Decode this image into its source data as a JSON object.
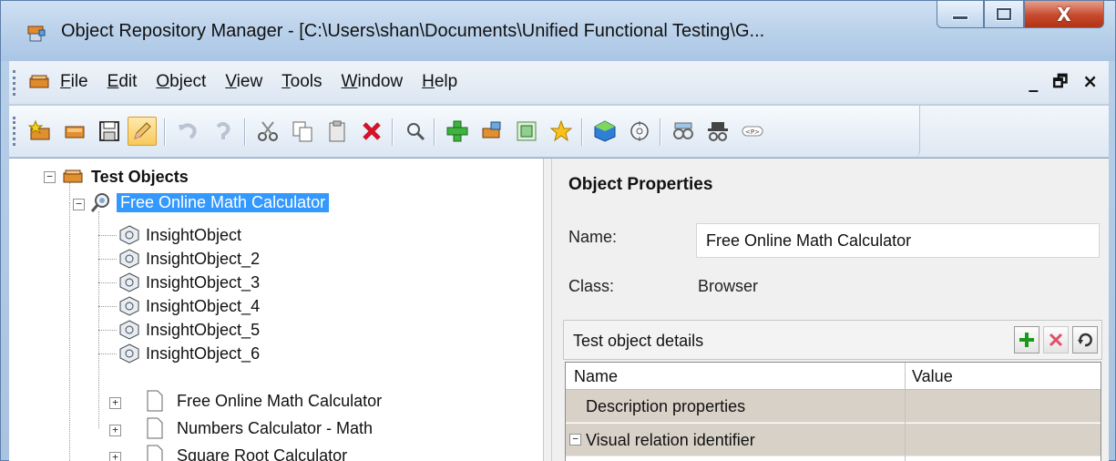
{
  "window": {
    "title": "Object Repository Manager - [C:\\Users\\shan\\Documents\\Unified Functional Testing\\G...",
    "minimize_label": "minimize",
    "maximize_label": "maximize",
    "close_glyph": "X"
  },
  "menubar": {
    "items": [
      {
        "pre": "",
        "accel": "F",
        "post": "ile"
      },
      {
        "pre": "",
        "accel": "E",
        "post": "dit"
      },
      {
        "pre": "",
        "accel": "O",
        "post": "bject"
      },
      {
        "pre": "",
        "accel": "V",
        "post": "iew"
      },
      {
        "pre": "",
        "accel": "T",
        "post": "ools"
      },
      {
        "pre": "",
        "accel": "W",
        "post": "indow"
      },
      {
        "pre": "",
        "accel": "H",
        "post": "elp"
      }
    ],
    "mdi_minimize": "_",
    "mdi_restore": "🗗",
    "mdi_close": "×"
  },
  "toolbar": {
    "icons": [
      "new-repository-icon",
      "open-repository-icon",
      "save-icon",
      "edit-pencil-icon",
      "undo-icon",
      "redo-icon",
      "cut-icon",
      "copy-icon",
      "paste-icon",
      "delete-icon",
      "find-icon",
      "add-objects-icon",
      "object-spy-icon",
      "highlight-icon",
      "star-icon",
      "export-icon",
      "navigate-icon",
      "compare-icon",
      "detective-icon",
      "property-tag-icon"
    ]
  },
  "tree": {
    "root": "Test Objects",
    "browser": "Free Online Math Calculator",
    "children": [
      "InsightObject",
      "InsightObject_2",
      "InsightObject_3",
      "InsightObject_4",
      "InsightObject_5",
      "InsightObject_6"
    ],
    "pages": [
      "Free Online Math Calculator",
      "Numbers Calculator - Math",
      "Square Root Calculator"
    ]
  },
  "properties": {
    "title": "Object Properties",
    "name_label": "Name:",
    "name_value": "Free Online Math Calculator",
    "class_label": "Class:",
    "class_value": "Browser",
    "details_label": "Test object details",
    "grid_headers": {
      "name": "Name",
      "value": "Value"
    },
    "rows": [
      "Description properties",
      "Visual relation identifier"
    ],
    "collapse_glyph": "−"
  },
  "colors": {
    "selection": "#3399ff",
    "add_green": "#1a9a1a",
    "remove_red": "#e0506a",
    "grid_row": "#d8d1c8"
  }
}
